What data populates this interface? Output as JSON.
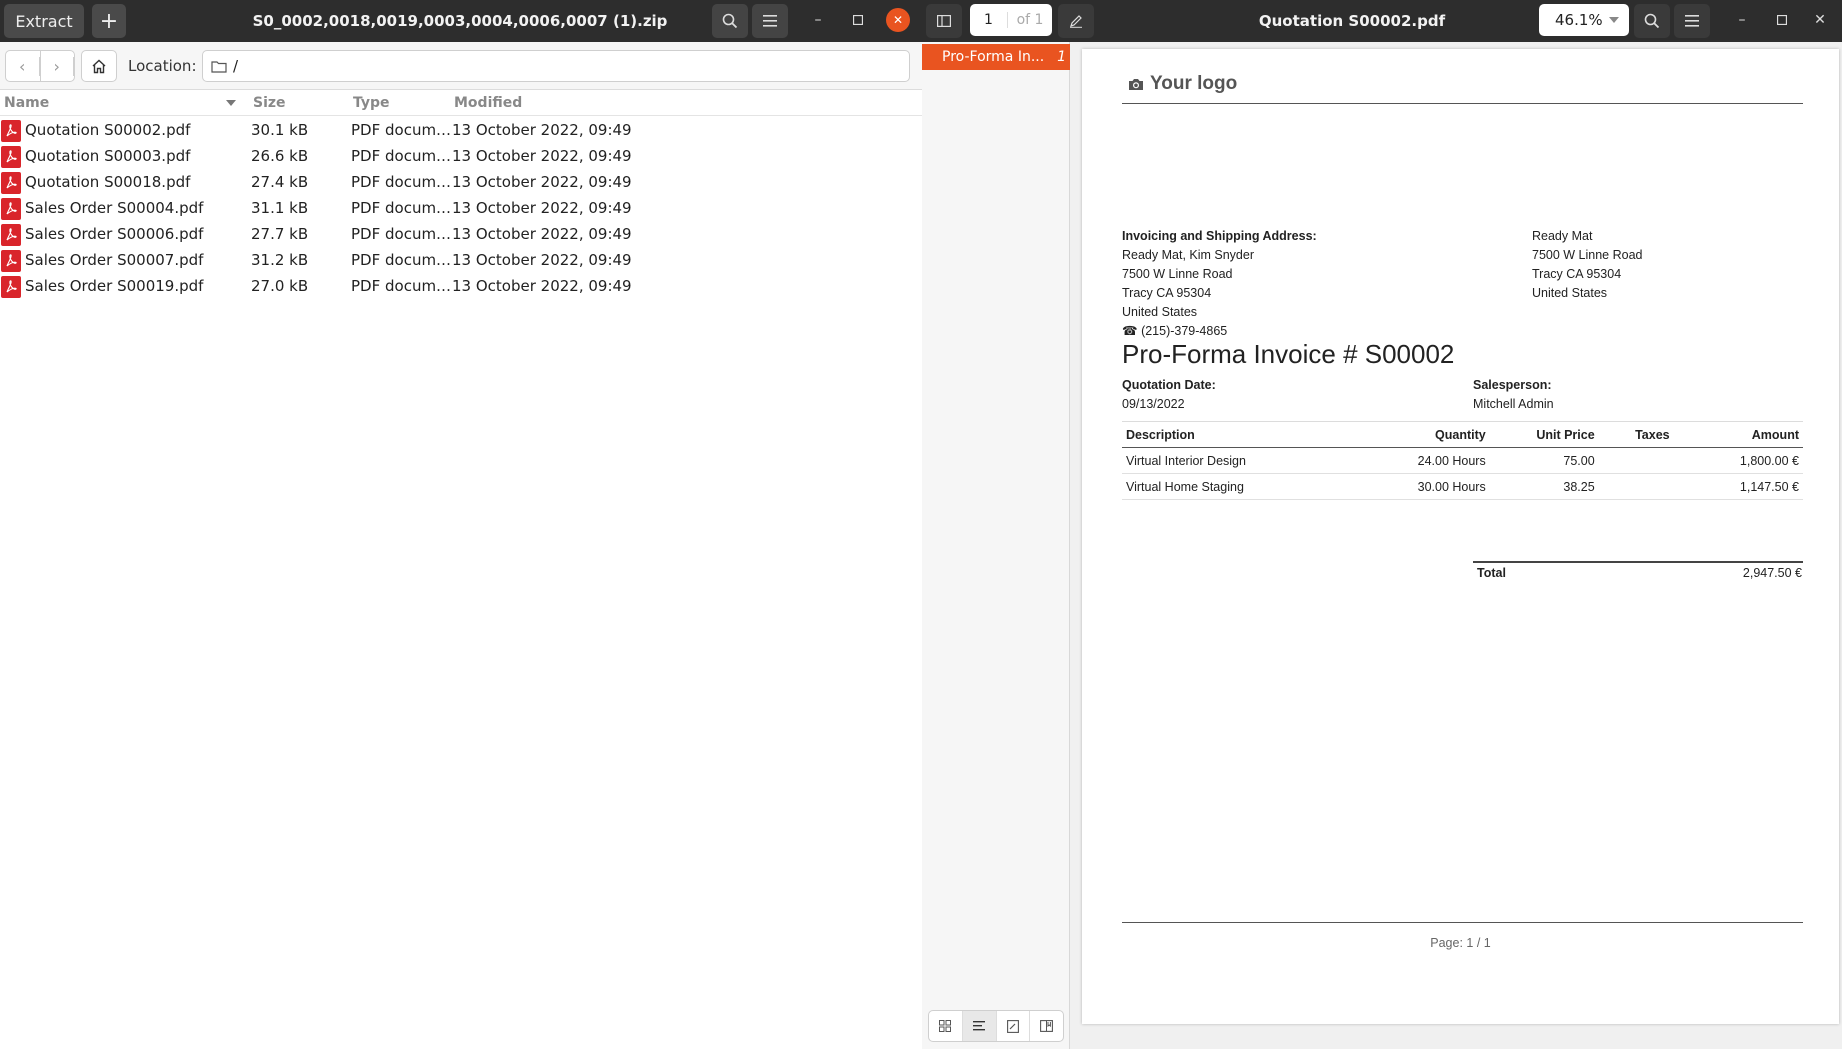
{
  "archive": {
    "title": "S0_0002,0018,0019,0003,0004,0006,0007 (1).zip",
    "extract_label": "Extract",
    "add_label": "+",
    "location_label": "Location:",
    "location_value": "/",
    "columns": {
      "name": "Name",
      "size": "Size",
      "type": "Type",
      "modified": "Modified"
    },
    "files": [
      {
        "name": "Quotation S00002.pdf",
        "size": "30.1 kB",
        "type": "PDF docum…",
        "modified": "13 October 2022, 09:49"
      },
      {
        "name": "Quotation S00003.pdf",
        "size": "26.6 kB",
        "type": "PDF docum…",
        "modified": "13 October 2022, 09:49"
      },
      {
        "name": "Quotation S00018.pdf",
        "size": "27.4 kB",
        "type": "PDF docum…",
        "modified": "13 October 2022, 09:49"
      },
      {
        "name": "Sales Order S00004.pdf",
        "size": "31.1 kB",
        "type": "PDF docum…",
        "modified": "13 October 2022, 09:49"
      },
      {
        "name": "Sales Order S00006.pdf",
        "size": "27.7 kB",
        "type": "PDF docum…",
        "modified": "13 October 2022, 09:49"
      },
      {
        "name": "Sales Order S00007.pdf",
        "size": "31.2 kB",
        "type": "PDF docum…",
        "modified": "13 October 2022, 09:49"
      },
      {
        "name": "Sales Order S00019.pdf",
        "size": "27.0 kB",
        "type": "PDF docum…",
        "modified": "13 October 2022, 09:49"
      }
    ]
  },
  "viewer": {
    "title": "Quotation S00002.pdf",
    "page_current": "1",
    "page_of": "of 1",
    "zoom": "46.1%",
    "outline": {
      "label": "Pro-Forma In...",
      "page": "1"
    },
    "accent_color": "#e95420"
  },
  "document": {
    "logo_text": "Your logo",
    "address_heading": "Invoicing and Shipping Address:",
    "address_lines": [
      "Ready Mat, Kim Snyder",
      "7500 W Linne Road",
      "Tracy CA 95304",
      "United States"
    ],
    "phone": "(215)-379-4865",
    "company_lines": [
      "Ready Mat",
      "7500 W Linne Road",
      "Tracy CA 95304",
      "United States"
    ],
    "title": "Pro-Forma Invoice # S00002",
    "quotation_date_label": "Quotation Date:",
    "quotation_date": "09/13/2022",
    "salesperson_label": "Salesperson:",
    "salesperson": "Mitchell Admin",
    "table_headers": {
      "description": "Description",
      "quantity": "Quantity",
      "unit_price": "Unit Price",
      "taxes": "Taxes",
      "amount": "Amount"
    },
    "lines": [
      {
        "description": "Virtual Interior Design",
        "quantity": "24.00 Hours",
        "unit_price": "75.00",
        "taxes": "",
        "amount": "1,800.00 €"
      },
      {
        "description": "Virtual Home Staging",
        "quantity": "30.00 Hours",
        "unit_price": "38.25",
        "taxes": "",
        "amount": "1,147.50 €"
      }
    ],
    "total_label": "Total",
    "total_value": "2,947.50 €",
    "footer_page": "Page: 1 / 1"
  }
}
